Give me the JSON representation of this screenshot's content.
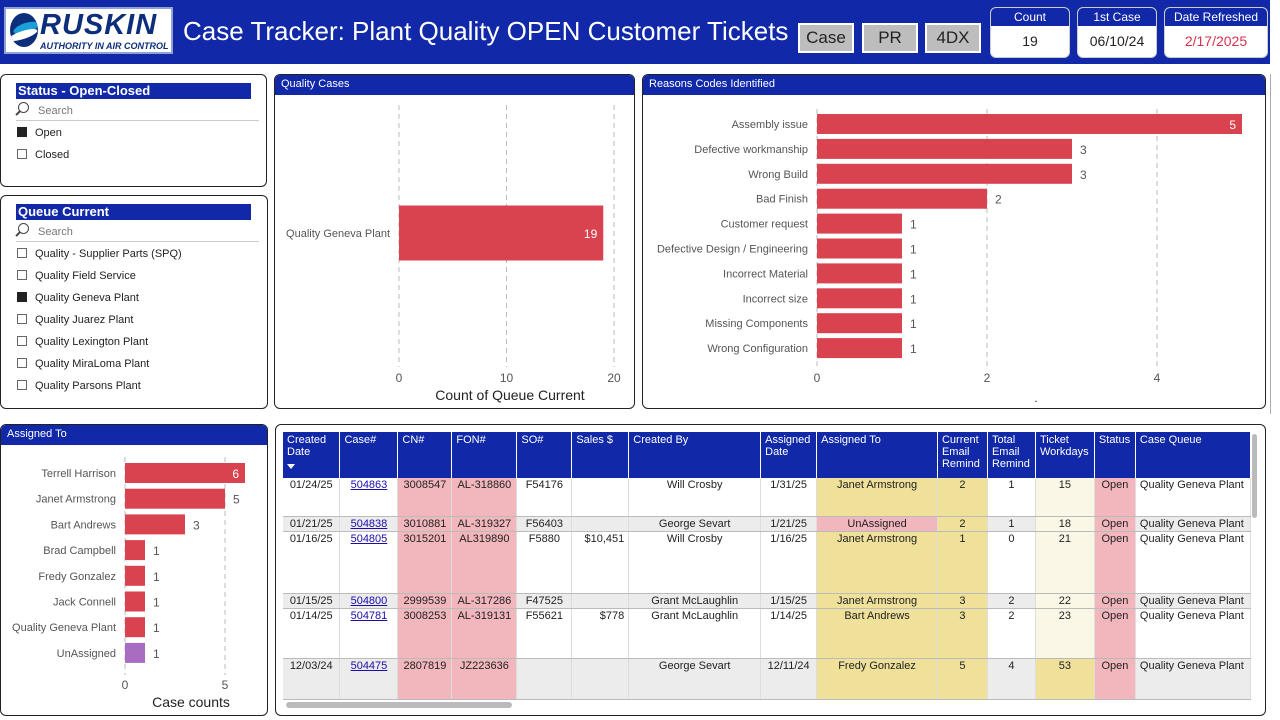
{
  "header": {
    "logo_text": "RUSKIN",
    "logo_tagline": "AUTHORITY IN AIR CONTROL",
    "title": "Case Tracker:  Plant Quality OPEN Customer Tickets",
    "buttons": [
      "Case",
      "PR",
      "4DX"
    ],
    "kpis": [
      {
        "label": "Count",
        "value": "19",
        "color": "#222222"
      },
      {
        "label": "1st Case",
        "value": "06/10/24",
        "color": "#222222"
      },
      {
        "label": "Date Refreshed",
        "value": "2/17/2025",
        "color": "#d9334a"
      }
    ]
  },
  "status_slicer": {
    "title": "Status - Open-Closed",
    "search_placeholder": "Search",
    "options": [
      {
        "label": "Open",
        "checked": true
      },
      {
        "label": "Closed",
        "checked": false
      }
    ]
  },
  "queue_slicer": {
    "title": "Queue Current",
    "search_placeholder": "Search",
    "options": [
      {
        "label": "Quality - Supplier Parts (SPQ)",
        "checked": false
      },
      {
        "label": "Quality Field Service",
        "checked": false
      },
      {
        "label": "Quality Geneva Plant",
        "checked": true
      },
      {
        "label": "Quality Juarez Plant",
        "checked": false
      },
      {
        "label": "Quality Lexington Plant",
        "checked": false
      },
      {
        "label": "Quality MiraLoma Plant",
        "checked": false
      },
      {
        "label": "Quality Parsons Plant",
        "checked": false
      }
    ]
  },
  "chart_data": [
    {
      "title": "Quality Cases",
      "type": "bar",
      "orientation": "horizontal",
      "categories": [
        "Quality Geneva Plant"
      ],
      "values": [
        19
      ],
      "xlabel": "Count of Queue Current",
      "xlim": [
        0,
        20
      ],
      "xticks": [
        0,
        10,
        20
      ],
      "bar_color": "#d9434f"
    },
    {
      "title": "Reasons Codes Identified",
      "type": "bar",
      "orientation": "horizontal",
      "categories": [
        "Assembly issue",
        "Defective workmanship",
        "Wrong Build",
        "Bad Finish",
        "Customer request",
        "Defective Design / Engineering",
        "Incorrect Material",
        "Incorrect size",
        "Missing Components",
        "Wrong Configuration"
      ],
      "values": [
        5,
        3,
        3,
        2,
        1,
        1,
        1,
        1,
        1,
        1
      ],
      "xlabel": ".",
      "xlim": [
        0,
        5
      ],
      "xticks": [
        0,
        2,
        4
      ],
      "bar_color": "#d9434f"
    },
    {
      "title": "Assigned To",
      "type": "bar",
      "orientation": "horizontal",
      "categories": [
        "Terrell Harrison",
        "Janet Armstrong",
        "Bart Andrews",
        "Brad Campbell",
        "Fredy Gonzalez",
        "Jack Connell",
        "Quality Geneva Plant",
        "UnAssigned"
      ],
      "values": [
        6,
        5,
        3,
        1,
        1,
        1,
        1,
        1
      ],
      "colors": [
        "#d9434f",
        "#d9434f",
        "#d9434f",
        "#d9434f",
        "#d9434f",
        "#d9434f",
        "#d9434f",
        "#a86cc1"
      ],
      "xlabel": "Case counts",
      "xlim": [
        0,
        6
      ],
      "xticks": [
        0,
        5
      ]
    }
  ],
  "table": {
    "columns": [
      "Created Date",
      "Case#",
      "CN#",
      "FON#",
      "SO#",
      "Sales $",
      "Created By",
      "Assigned Date",
      "Assigned To",
      "Current Email Remind",
      "Total Email Remind",
      "Ticket Workdays",
      "Status",
      "Case Queue"
    ],
    "rows": [
      [
        "01/24/25",
        "504863",
        "3008547",
        "AL-318860",
        "F54176",
        "",
        "Will Crosby",
        "1/31/25",
        "Janet Armstrong",
        "2",
        "1",
        "15",
        "Open",
        "Quality Geneva Plant"
      ],
      [
        "01/21/25",
        "504838",
        "3010881",
        "AL-319327",
        "F56403",
        "",
        "George Sevart",
        "1/21/25",
        "UnAssigned",
        "2",
        "1",
        "18",
        "Open",
        "Quality Geneva Plant"
      ],
      [
        "01/16/25",
        "504805",
        "3015201",
        "AL319890",
        "F5880",
        "$10,451",
        "Will Crosby",
        "1/16/25",
        "Janet Armstrong",
        "1",
        "0",
        "21",
        "Open",
        "Quality Geneva Plant"
      ],
      [
        "01/15/25",
        "504800",
        "2999539",
        "AL-317286",
        "F47525",
        "",
        "Grant McLaughlin",
        "1/15/25",
        "Janet Armstrong",
        "3",
        "2",
        "22",
        "Open",
        "Quality Geneva Plant"
      ],
      [
        "01/14/25",
        "504781",
        "3008253",
        "AL-319131",
        "F55621",
        "$778",
        "Grant McLaughlin",
        "1/14/25",
        "Bart Andrews",
        "3",
        "2",
        "23",
        "Open",
        "Quality Geneva Plant"
      ],
      [
        "12/03/24",
        "504475",
        "2807819",
        "JZ223636",
        "",
        "",
        "George Sevart",
        "12/11/24",
        "Fredy Gonzalez",
        "5",
        "4",
        "53",
        "Open",
        "Quality Geneva Plant"
      ]
    ]
  }
}
